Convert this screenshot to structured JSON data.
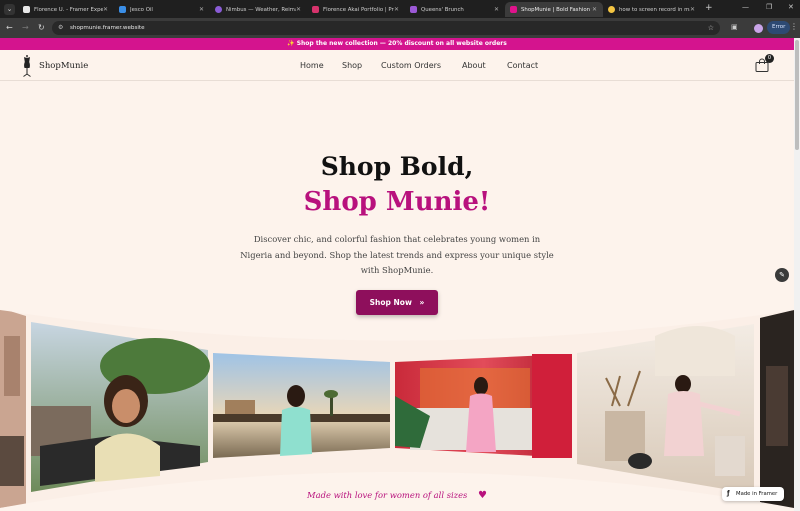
{
  "browser": {
    "tabs": [
      {
        "title": "Florence U. - Framer Expert",
        "favicon_color": "#e8e8e8",
        "active": false
      },
      {
        "title": "Jesco Oil",
        "favicon_color": "#3a8ee6",
        "active": false
      },
      {
        "title": "Nimbus — Weather, Reimagined",
        "favicon_color": "#8a5cd6",
        "active": false
      },
      {
        "title": "Florence Akai Portfolio | Product",
        "favicon_color": "#d6336c",
        "active": false
      },
      {
        "title": "Queens' Brunch",
        "favicon_color": "#9b59d6",
        "active": false
      },
      {
        "title": "ShopMunie | Bold Fashion for",
        "favicon_color": "#e0138c",
        "active": true
      },
      {
        "title": "how to screen record in mac",
        "favicon_color": "#f4c542",
        "active": false
      }
    ],
    "url": "shopmunie.framer.website",
    "error_label": "Error"
  },
  "site": {
    "promo_text": "✨ Shop the new collection — 20% discount on all website orders",
    "brand": "ShopMunie",
    "nav": [
      "Home",
      "Shop",
      "Custom Orders",
      "About",
      "Contact"
    ],
    "cart_count": "0",
    "hero_line1": "Shop Bold,",
    "hero_line2": "Shop Munie!",
    "hero_description": "Discover  chic, and colorful fashion that celebrates young women in Nigeria and beyond. Shop the latest trends and express your unique style with ShopMunie.",
    "cta_label": "Shop Now",
    "tagline": "Made with love for women of all sizes",
    "framer_badge": "Made in Framer"
  },
  "colors": {
    "brand_pink": "#d4148e",
    "brand_magenta": "#b8117d",
    "cta_purple": "#8e0f5c",
    "page_background": "#fdf3ec"
  },
  "icons": [
    "search-tabs-icon",
    "back-icon",
    "forward-icon",
    "reload-icon",
    "site-info-icon",
    "bookmark-star-icon",
    "extensions-icon",
    "dress-form-icon",
    "shopping-bag-icon",
    "edit-pencil-icon",
    "heart-icon",
    "framer-icon",
    "chevrons-right-icon"
  ]
}
